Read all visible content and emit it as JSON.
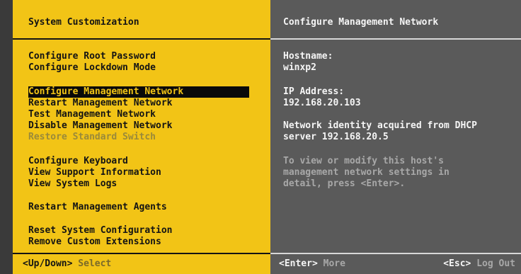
{
  "left": {
    "title": "System Customization",
    "menu": [
      {
        "label": "Configure Root Password",
        "state": "normal"
      },
      {
        "label": "Configure Lockdown Mode",
        "state": "normal"
      },
      {
        "label": "Configure Management Network",
        "state": "selected"
      },
      {
        "label": "Restart Management Network",
        "state": "normal"
      },
      {
        "label": "Test Management Network",
        "state": "normal"
      },
      {
        "label": "Disable Management Network",
        "state": "normal"
      },
      {
        "label": "Restore Standard Switch",
        "state": "disabled"
      },
      {
        "label": "Configure Keyboard",
        "state": "normal"
      },
      {
        "label": "View Support Information",
        "state": "normal"
      },
      {
        "label": "View System Logs",
        "state": "normal"
      },
      {
        "label": "Restart Management Agents",
        "state": "normal"
      },
      {
        "label": "Reset System Configuration",
        "state": "normal"
      },
      {
        "label": "Remove Custom Extensions",
        "state": "normal"
      }
    ],
    "footer": {
      "key": "<Up/Down>",
      "desc": "Select"
    }
  },
  "right": {
    "title": "Configure Management Network",
    "hostname_label": "Hostname:",
    "hostname_value": "winxp2",
    "ip_label": "IP Address:",
    "ip_value": "192.168.20.103",
    "identity_line1": "Network identity acquired from DHCP",
    "identity_line2": "server 192.168.20.5",
    "help_line1": "To view or modify this host's",
    "help_line2": "management network settings in",
    "help_line3": "detail, press <Enter>.",
    "footer": {
      "enter_key": "<Enter>",
      "enter_desc": "More",
      "esc_key": "<Esc>",
      "esc_desc": "Log Out"
    }
  },
  "colors": {
    "accent_yellow": "#f2c416",
    "panel_grey": "#5a5a5a",
    "selected_bg": "#0a0a0a"
  }
}
